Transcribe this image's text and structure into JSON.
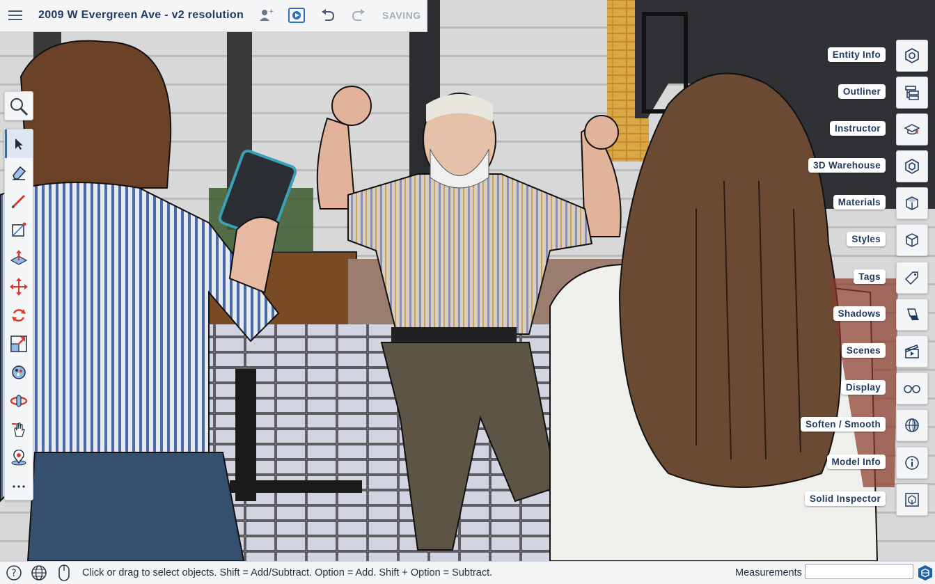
{
  "topbar": {
    "title": "2009 W Evergreen Ave - v2 resolution",
    "status": "SAVING",
    "icons": [
      "menu-icon",
      "add-collaborator-icon",
      "present-icon",
      "undo-icon",
      "redo-icon"
    ]
  },
  "left_toolbar": {
    "search_icon": "magnifier-icon",
    "tools": [
      {
        "name": "select",
        "icon": "cursor-arrow-icon",
        "active": true
      },
      {
        "name": "eraser",
        "icon": "eraser-icon"
      },
      {
        "name": "line",
        "icon": "pencil-icon"
      },
      {
        "name": "rectangle",
        "icon": "rectangle-icon"
      },
      {
        "name": "push-pull",
        "icon": "push-pull-icon"
      },
      {
        "name": "move",
        "icon": "move-arrows-icon"
      },
      {
        "name": "rotate",
        "icon": "rotate-icon"
      },
      {
        "name": "scale",
        "icon": "scale-icon"
      },
      {
        "name": "paint-bucket",
        "icon": "paint-bucket-icon"
      },
      {
        "name": "orbit",
        "icon": "orbit-icon"
      },
      {
        "name": "pan",
        "icon": "pan-hand-icon"
      },
      {
        "name": "position-camera",
        "icon": "position-camera-icon"
      },
      {
        "name": "more",
        "icon": "more-dots-icon"
      }
    ]
  },
  "right_panels": [
    {
      "label": "Entity Info",
      "icon": "entity-info-icon"
    },
    {
      "label": "Outliner",
      "icon": "outliner-icon"
    },
    {
      "label": "Instructor",
      "icon": "graduation-cap-icon"
    },
    {
      "label": "3D Warehouse",
      "icon": "warehouse-icon"
    },
    {
      "label": "Materials",
      "icon": "materials-cube-icon"
    },
    {
      "label": "Styles",
      "icon": "styles-cube-icon"
    },
    {
      "label": "Tags",
      "icon": "tag-icon"
    },
    {
      "label": "Shadows",
      "icon": "shadow-icon"
    },
    {
      "label": "Scenes",
      "icon": "clapperboard-icon"
    },
    {
      "label": "Display",
      "icon": "glasses-icon"
    },
    {
      "label": "Soften / Smooth",
      "icon": "soften-sphere-icon"
    },
    {
      "label": "Model Info",
      "icon": "info-icon"
    },
    {
      "label": "Solid Inspector",
      "icon": "solid-inspector-icon"
    }
  ],
  "statusbar": {
    "hint": "Click or drag to select objects. Shift = Add/Subtract. Option = Add. Shift + Option = Subtract.",
    "measurements_label": "Measurements",
    "measurements_value": "",
    "icons": [
      "help-icon",
      "globe-icon",
      "mouse-icon",
      "sketchup-logo-icon"
    ]
  },
  "colors": {
    "accent": "#2d6fb8",
    "title_text": "#1f3a5f",
    "tool_red": "#d93a2b",
    "chrome_bg": "#f4f5f7"
  }
}
